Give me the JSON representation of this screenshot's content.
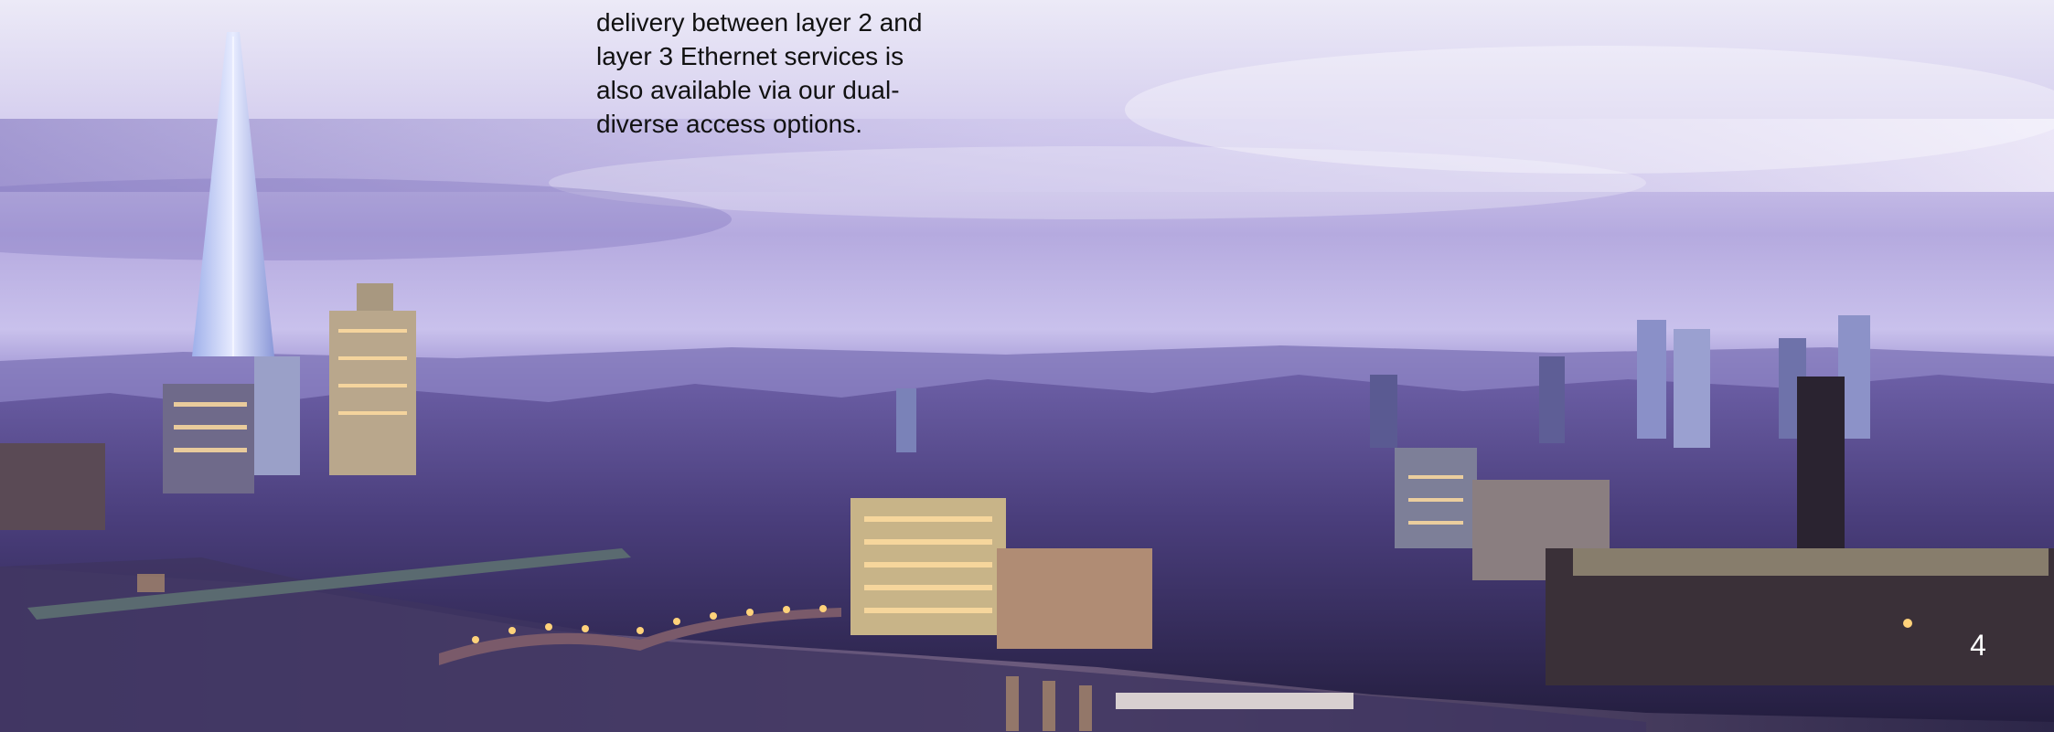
{
  "body_text": {
    "lines": [
      "delivery between layer 2 and",
      "layer 3 Ethernet services is",
      "also available via our dual-",
      "diverse access options."
    ]
  },
  "page_number": "4",
  "colors": {
    "sky_top": "#e9e6f6",
    "sky_mid": "#b8aee0",
    "sky_horizon": "#8c80c8",
    "city_shadow": "#2c2548",
    "city_mid": "#4b3f78",
    "river": "#3a3360",
    "window_light": "#ffd27a",
    "text": "#111111",
    "page_number": "#ffffff"
  }
}
